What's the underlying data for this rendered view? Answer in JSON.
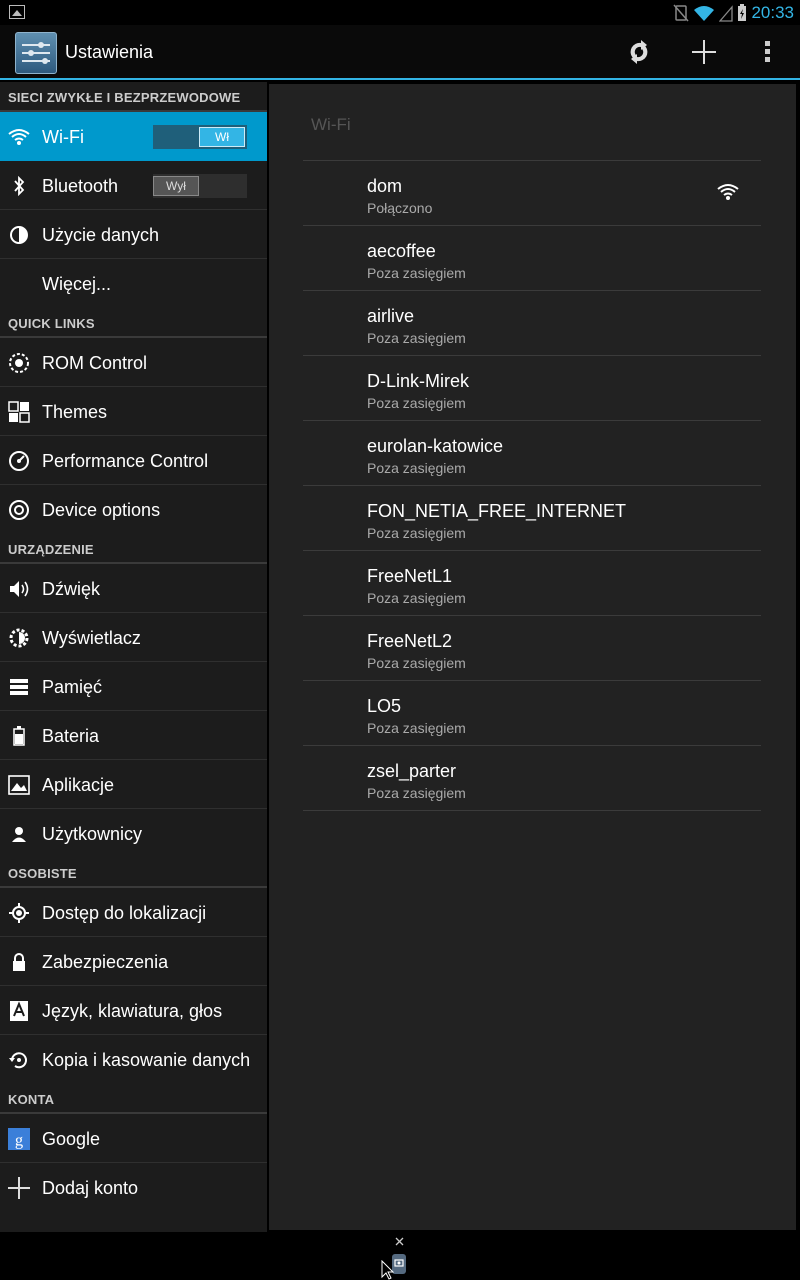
{
  "statusbar": {
    "time": "20:33",
    "icons": [
      "image-icon",
      "no-sim-icon",
      "wifi-icon",
      "signal-icon",
      "battery-icon"
    ]
  },
  "actionbar": {
    "title": "Ustawienia",
    "icons": [
      "settings-app-icon",
      "sync-icon",
      "add-icon",
      "overflow-icon"
    ]
  },
  "sidebar": {
    "sections": [
      {
        "header": "SIECI ZWYKŁE I BEZPRZEWODOWE",
        "items": [
          {
            "label": "Wi-Fi",
            "icon": "wifi-icon",
            "selected": true,
            "toggle": "Wł"
          },
          {
            "label": "Bluetooth",
            "icon": "bluetooth-icon",
            "toggle": "Wył"
          },
          {
            "label": "Użycie danych",
            "icon": "data-usage-icon"
          },
          {
            "label": "Więcej...",
            "icon": ""
          }
        ]
      },
      {
        "header": "QUICK LINKS",
        "items": [
          {
            "label": "ROM Control",
            "icon": "rom-control-icon"
          },
          {
            "label": "Themes",
            "icon": "themes-icon"
          },
          {
            "label": "Performance Control",
            "icon": "performance-icon"
          },
          {
            "label": "Device options",
            "icon": "device-options-icon"
          }
        ]
      },
      {
        "header": "URZĄDZENIE",
        "items": [
          {
            "label": "Dźwięk",
            "icon": "sound-icon"
          },
          {
            "label": "Wyświetlacz",
            "icon": "display-icon"
          },
          {
            "label": "Pamięć",
            "icon": "storage-icon"
          },
          {
            "label": "Bateria",
            "icon": "battery-icon"
          },
          {
            "label": "Aplikacje",
            "icon": "apps-icon"
          },
          {
            "label": "Użytkownicy",
            "icon": "users-icon"
          }
        ]
      },
      {
        "header": "OSOBISTE",
        "items": [
          {
            "label": "Dostęp do lokalizacji",
            "icon": "location-icon"
          },
          {
            "label": "Zabezpieczenia",
            "icon": "lock-icon"
          },
          {
            "label": "Język, klawiatura, głos",
            "icon": "language-icon"
          },
          {
            "label": "Kopia i kasowanie danych",
            "icon": "backup-icon"
          }
        ]
      },
      {
        "header": "KONTA",
        "items": [
          {
            "label": "Google",
            "icon": "google-icon"
          },
          {
            "label": "Dodaj konto",
            "icon": "add-icon"
          }
        ]
      }
    ]
  },
  "wifi": {
    "title": "Wi-Fi",
    "networks": [
      {
        "ssid": "dom",
        "status": "Połączono",
        "signal": true
      },
      {
        "ssid": "aecoffee",
        "status": "Poza zasięgiem"
      },
      {
        "ssid": "airlive",
        "status": "Poza zasięgiem"
      },
      {
        "ssid": "D-Link-Mirek",
        "status": "Poza zasięgiem"
      },
      {
        "ssid": "eurolan-katowice",
        "status": "Poza zasięgiem"
      },
      {
        "ssid": "FON_NETIA_FREE_INTERNET",
        "status": "Poza zasięgiem"
      },
      {
        "ssid": "FreeNetL1",
        "status": "Poza zasięgiem"
      },
      {
        "ssid": "FreeNetL2",
        "status": "Poza zasięgiem"
      },
      {
        "ssid": "LO5",
        "status": "Poza zasięgiem"
      },
      {
        "ssid": "zsel_parter",
        "status": "Poza zasięgiem"
      }
    ]
  }
}
